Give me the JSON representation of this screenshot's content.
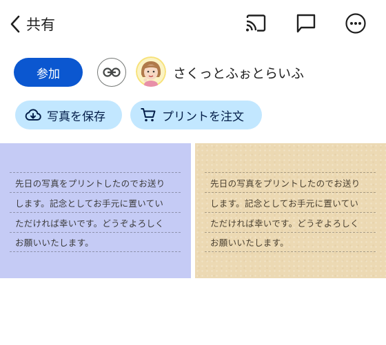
{
  "header": {
    "back_label": "共有"
  },
  "actions": {
    "join_label": "参加",
    "owner_name": "さくっとふぉとらいふ"
  },
  "chips": [
    {
      "label": "写真を保存",
      "icon": "cloud-download-icon"
    },
    {
      "label": "プリントを注文",
      "icon": "cart-icon"
    }
  ],
  "photos": [
    {
      "background": "#c5cbf5",
      "lines": [
        "先日の写真をプリントしたのでお送り",
        "します。記念としてお手元に置いてい",
        "ただければ幸いです。どうぞよろしく",
        "お願いいたします。"
      ]
    },
    {
      "background": "#ecd9b3",
      "lines": [
        "先日の写真をプリントしたのでお送り",
        "します。記念としてお手元に置いてい",
        "ただければ幸いです。どうぞよろしく",
        "お願いいたします。"
      ]
    }
  ],
  "colors": {
    "primary": "#0b57d0",
    "chip": "#c2e7ff"
  }
}
